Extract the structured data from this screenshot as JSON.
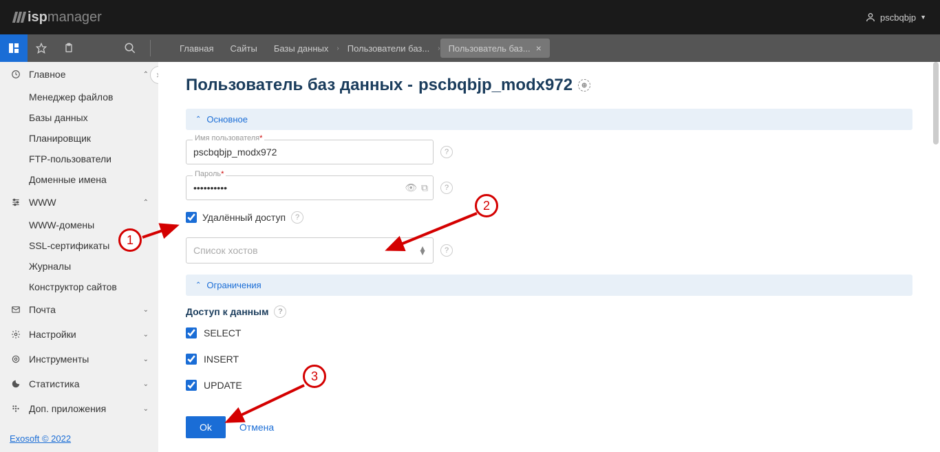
{
  "header": {
    "logo_prefix": "isp",
    "logo_suffix": "manager",
    "username": "pscbqbjp"
  },
  "breadcrumbs": {
    "items": [
      "Главная",
      "Сайты",
      "Базы данных",
      "Пользователи баз...",
      "Пользователь баз..."
    ]
  },
  "sidebar": {
    "sections": [
      {
        "title": "Главное",
        "expanded": true,
        "items": [
          "Менеджер файлов",
          "Базы данных",
          "Планировщик",
          "FTP-пользователи",
          "Доменные имена"
        ]
      },
      {
        "title": "WWW",
        "expanded": true,
        "items": [
          "WWW-домены",
          "SSL-сертификаты",
          "Журналы",
          "Конструктор сайтов"
        ]
      },
      {
        "title": "Почта",
        "expanded": false,
        "items": []
      },
      {
        "title": "Настройки",
        "expanded": false,
        "items": []
      },
      {
        "title": "Инструменты",
        "expanded": false,
        "items": []
      },
      {
        "title": "Статистика",
        "expanded": false,
        "items": []
      },
      {
        "title": "Доп. приложения",
        "expanded": false,
        "items": []
      }
    ],
    "footer": "Exosoft © 2022"
  },
  "page": {
    "title_prefix": "Пользователь баз данных - ",
    "title_name": "pscbqbjp_modx972",
    "section_main": "Основное",
    "section_restrict": "Ограничения",
    "field_username_label": "Имя пользователя",
    "field_username_value": "pscbqbjp_modx972",
    "field_password_label": "Пароль",
    "field_password_value": "••••••••••",
    "remote_access_label": "Удалённый доступ",
    "remote_access_checked": true,
    "host_list_placeholder": "Список хостов",
    "data_access_title": "Доступ к данным",
    "perms": [
      {
        "name": "SELECT",
        "checked": true
      },
      {
        "name": "INSERT",
        "checked": true
      },
      {
        "name": "UPDATE",
        "checked": true
      }
    ],
    "btn_ok": "Ok",
    "btn_cancel": "Отмена"
  },
  "annotations": {
    "n1": "1",
    "n2": "2",
    "n3": "3"
  }
}
